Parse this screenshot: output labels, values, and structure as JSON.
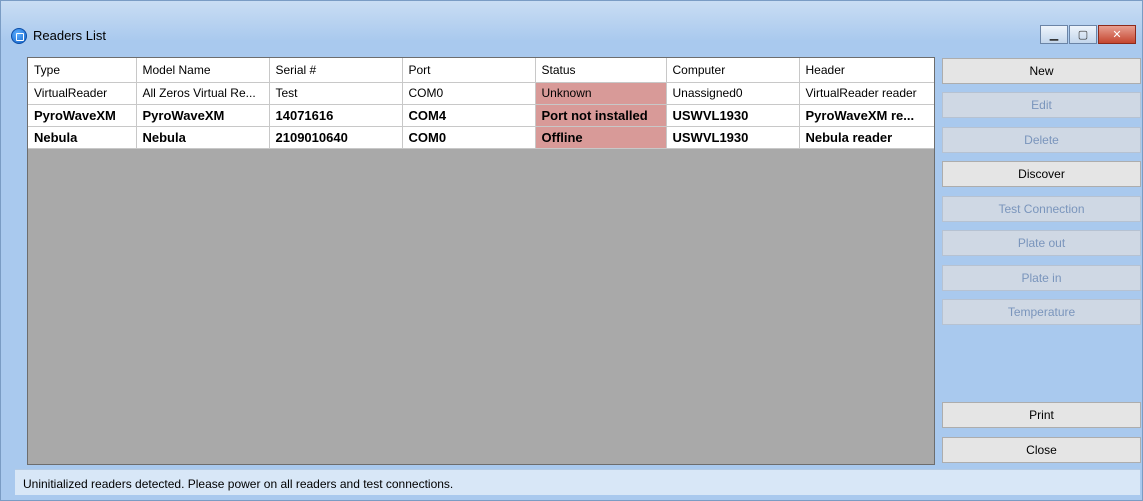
{
  "window": {
    "title": "Readers List",
    "minimize_label": "▁",
    "maximize_label": "▢",
    "close_label": "✕"
  },
  "table": {
    "columns": [
      "Type",
      "Model Name",
      "Serial #",
      "Port",
      "Status",
      "Computer",
      "Header"
    ],
    "rows": [
      {
        "cells": [
          "VirtualReader",
          "All Zeros Virtual Re...",
          "Test",
          "COM0",
          "Unknown",
          "Unassigned0",
          "VirtualReader reader"
        ],
        "bold": false
      },
      {
        "cells": [
          "PyroWaveXM",
          "PyroWaveXM",
          "14071616",
          "COM4",
          "Port not installed",
          "USWVL1930",
          "PyroWaveXM re..."
        ],
        "bold": true
      },
      {
        "cells": [
          "Nebula",
          "Nebula",
          "2109010640",
          "COM0",
          "Offline",
          "USWVL1930",
          "Nebula reader"
        ],
        "bold": true
      }
    ],
    "status_color": "#d89a98"
  },
  "buttons": {
    "new": {
      "label": "New",
      "mnemonic": "N",
      "enabled": true
    },
    "edit": {
      "label": "Edit",
      "mnemonic": "i",
      "enabled": false
    },
    "delete": {
      "label": "Delete",
      "mnemonic": "D",
      "enabled": false
    },
    "discover": {
      "label": "Discover",
      "mnemonic": "s",
      "enabled": true
    },
    "test_connection": {
      "label": "Test Connection",
      "mnemonic": "T",
      "enabled": false
    },
    "plate_out": {
      "label": "Plate out",
      "enabled": false
    },
    "plate_in": {
      "label": "Plate in",
      "enabled": false
    },
    "temperature": {
      "label": "Temperature",
      "enabled": false
    },
    "print": {
      "label": "Print",
      "mnemonic": "P",
      "enabled": true
    },
    "close": {
      "label": "Close",
      "mnemonic": "C",
      "enabled": true
    }
  },
  "statusbar": {
    "message": "Uninitialized readers detected.  Please power on all readers and test connections."
  }
}
